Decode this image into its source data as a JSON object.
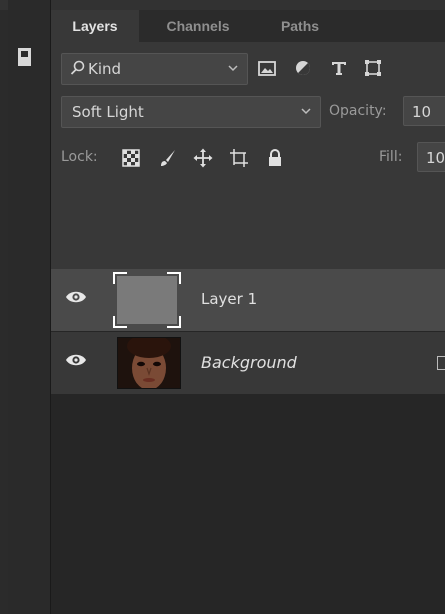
{
  "panel": {
    "tabs": [
      {
        "label": "Layers",
        "active": true
      },
      {
        "label": "Channels",
        "active": false
      },
      {
        "label": "Paths",
        "active": false
      }
    ]
  },
  "filter": {
    "kind_label": "Kind",
    "icons": [
      "image-filter-icon",
      "adjustment-filter-icon",
      "type-filter-icon",
      "shape-filter-icon"
    ]
  },
  "blend": {
    "mode": "Soft Light",
    "opacity_label": "Opacity:",
    "opacity_value": "10"
  },
  "lock": {
    "label": "Lock:",
    "fill_label": "Fill:",
    "fill_value": "10"
  },
  "layers": [
    {
      "name": "Layer 1",
      "selected": true,
      "visible": true
    },
    {
      "name": "Background",
      "selected": false,
      "visible": true,
      "locked": true
    }
  ],
  "colors": {
    "panel_bg": "#383838",
    "selected_row": "#4a4a4a",
    "list_bg": "#262626"
  }
}
